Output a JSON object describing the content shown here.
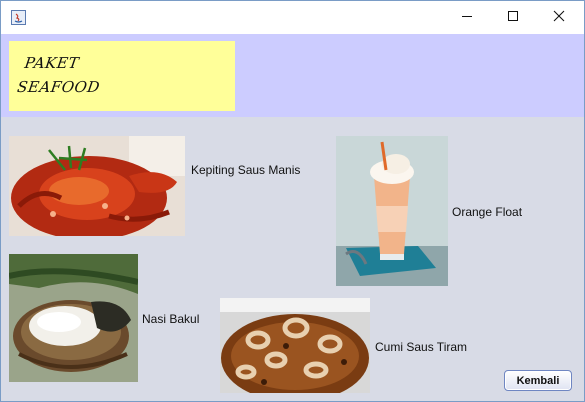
{
  "window": {
    "icon": "java-app-icon"
  },
  "controls": {
    "minimize": "minimize-icon",
    "maximize": "maximize-icon",
    "close": "close-icon"
  },
  "header": {
    "logo_line1": "PAKET",
    "logo_line2": "SEAFOOD",
    "band_color": "#ccccff",
    "logo_bg": "#ffff99"
  },
  "menu": {
    "items": [
      {
        "label": "Kepiting Saus Manis",
        "image": "crab-dish-photo"
      },
      {
        "label": "Orange Float",
        "image": "orange-float-photo"
      },
      {
        "label": "Nasi Bakul",
        "image": "rice-basket-photo"
      },
      {
        "label": "Cumi Saus Tiram",
        "image": "squid-dish-photo"
      }
    ]
  },
  "footer": {
    "back_label": "Kembali"
  }
}
